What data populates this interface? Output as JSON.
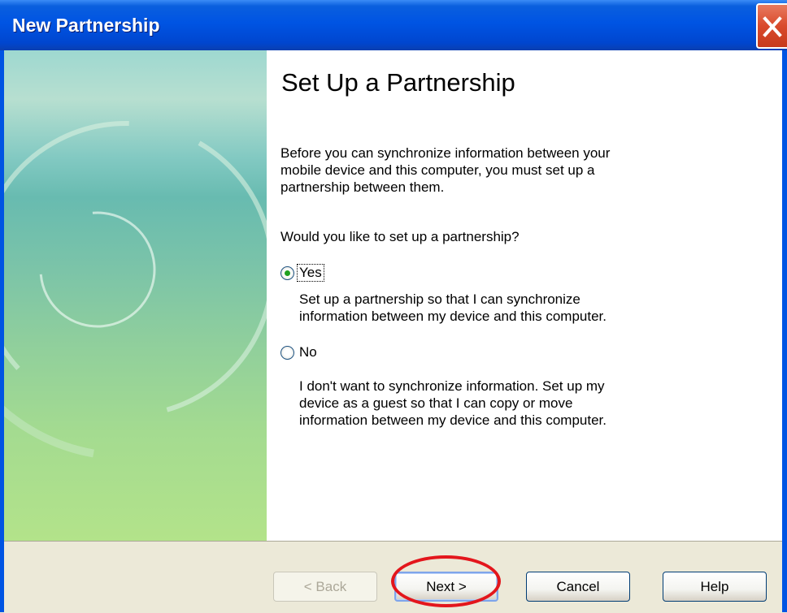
{
  "window": {
    "title": "New Partnership",
    "close_icon": "close-icon"
  },
  "content": {
    "heading": "Set Up a Partnership",
    "intro_lines": [
      "Before you can synchronize information between your",
      "mobile device and this computer, you must set up a",
      "partnership between them."
    ],
    "question": "Would you like to set up a partnership?",
    "options": [
      {
        "label": "Yes",
        "selected": true,
        "description": [
          "Set up a partnership so that I can synchronize",
          "information between my device and this computer."
        ]
      },
      {
        "label": "No",
        "selected": false,
        "description": [
          "I don't want to synchronize information. Set up my",
          "device as a guest so that I can copy or move",
          "information between my device and this computer."
        ]
      }
    ]
  },
  "buttons": {
    "back": {
      "label": "< Back",
      "enabled": false
    },
    "next": {
      "label": "Next >",
      "enabled": true,
      "default": true
    },
    "cancel": {
      "label": "Cancel",
      "enabled": true
    },
    "help": {
      "label": "Help",
      "enabled": true
    }
  },
  "colors": {
    "titlebar": "#0054e3",
    "close_button": "#d94a2c",
    "annotation_circle": "#e3161c",
    "radio_selected": "#21a121"
  }
}
